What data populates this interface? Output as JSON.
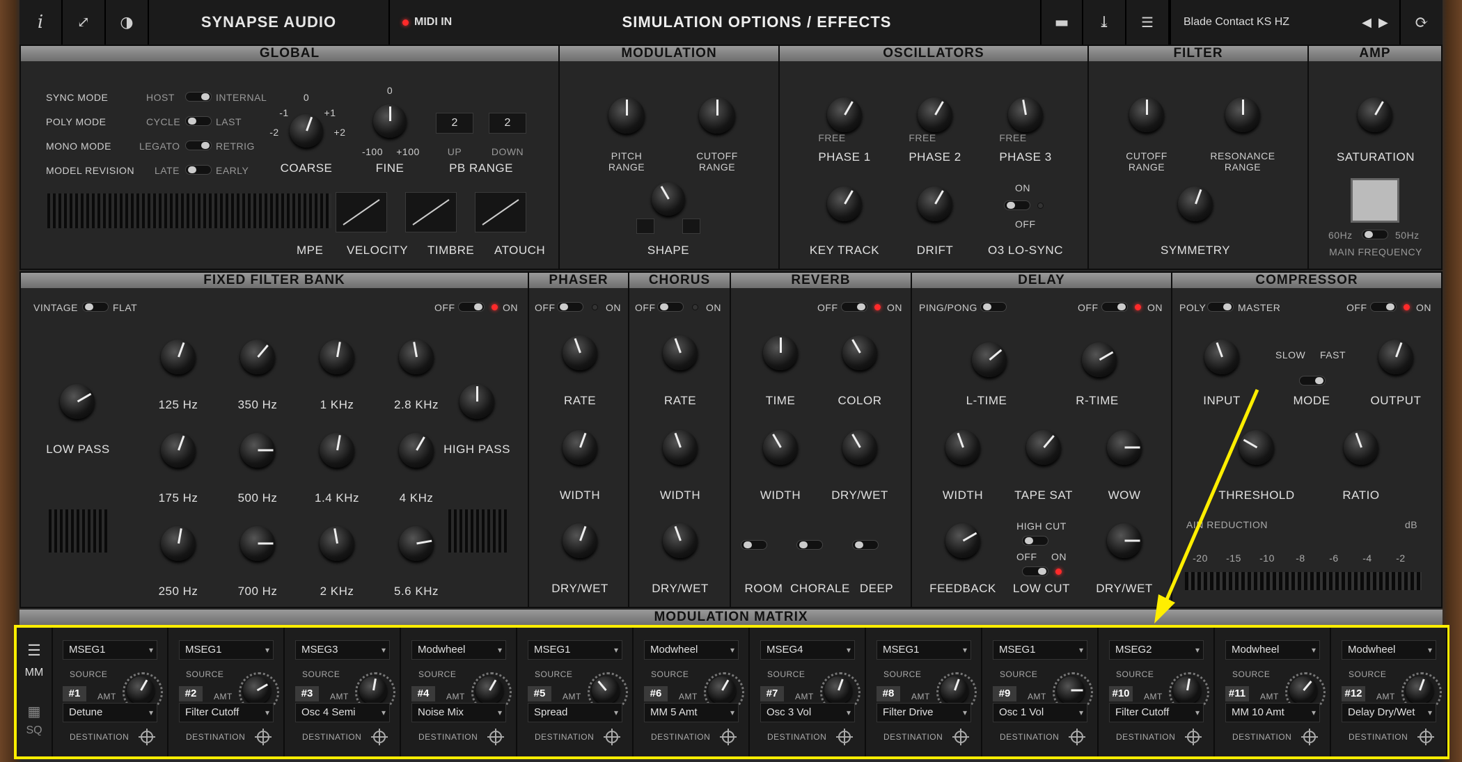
{
  "topbar": {
    "brand": "SYNAPSE AUDIO",
    "midi": "MIDI IN",
    "title": "SIMULATION OPTIONS / EFFECTS",
    "preset": "Blade Contact KS HZ",
    "info_icon": "i",
    "expand_icon": "expand-icon",
    "theme_icon": "contrast-icon"
  },
  "global": {
    "title": "GLOBAL",
    "sync_mode": "SYNC MODE",
    "host": "HOST",
    "internal": "INTERNAL",
    "poly_mode": "POLY MODE",
    "cycle": "CYCLE",
    "last": "LAST",
    "mono_mode": "MONO MODE",
    "legato": "LEGATO",
    "retrig": "RETRIG",
    "model_revision": "MODEL REVISION",
    "late": "LATE",
    "early": "EARLY",
    "coarse": "COARSE",
    "fine": "FINE",
    "pb_range": "PB RANGE",
    "up": "UP",
    "down": "DOWN",
    "pb_up": "2",
    "pb_down": "2",
    "coarse_0": "0",
    "coarse_m1": "-1",
    "coarse_p1": "+1",
    "coarse_m2": "-2",
    "coarse_p2": "+2",
    "fine_0": "0",
    "fine_m": "-100",
    "fine_p": "+100",
    "mpe": "MPE",
    "velocity": "VELOCITY",
    "timbre": "TIMBRE",
    "atouch": "ATOUCH"
  },
  "modulation": {
    "title": "MODULATION",
    "pitch_range": "PITCH\nRANGE",
    "cutoff_range": "CUTOFF\nRANGE",
    "shape": "SHAPE"
  },
  "oscillators": {
    "title": "OSCILLATORS",
    "phase1": "PHASE 1",
    "phase2": "PHASE 2",
    "phase3": "PHASE 3",
    "free": "FREE",
    "key_track": "KEY TRACK",
    "drift": "DRIFT",
    "lo_sync": "O3 LO-SYNC",
    "on": "ON",
    "off": "OFF"
  },
  "filter": {
    "title": "FILTER",
    "cutoff_range": "CUTOFF\nRANGE",
    "resonance_range": "RESONANCE\nRANGE",
    "symmetry": "SYMMETRY"
  },
  "amp": {
    "title": "AMP",
    "saturation": "SATURATION",
    "hz60": "60Hz",
    "hz50": "50Hz",
    "main_frequency": "MAIN FREQUENCY"
  },
  "ffb": {
    "title": "FIXED FILTER BANK",
    "vintage": "VINTAGE",
    "flat": "FLAT",
    "off": "OFF",
    "on": "ON",
    "low_pass": "LOW PASS",
    "high_pass": "HIGH PASS",
    "bands": [
      "125 Hz",
      "350 Hz",
      "1 KHz",
      "2.8 KHz",
      "175 Hz",
      "500 Hz",
      "1.4 KHz",
      "4 KHz",
      "250 Hz",
      "700 Hz",
      "2 KHz",
      "5.6 KHz"
    ]
  },
  "phaser": {
    "title": "PHASER",
    "off": "OFF",
    "on": "ON",
    "rate": "RATE",
    "width": "WIDTH",
    "drywet": "DRY/WET"
  },
  "chorus": {
    "title": "CHORUS",
    "off": "OFF",
    "on": "ON",
    "rate": "RATE",
    "width": "WIDTH",
    "drywet": "DRY/WET"
  },
  "reverb": {
    "title": "REVERB",
    "off": "OFF",
    "on": "ON",
    "time": "TIME",
    "color": "COLOR",
    "width": "WIDTH",
    "drywet": "DRY/WET",
    "room": "ROOM",
    "chorale": "CHORALE",
    "deep": "DEEP"
  },
  "delay": {
    "title": "DELAY",
    "pingpong": "PING/PONG",
    "off": "OFF",
    "on": "ON",
    "ltime": "L-TIME",
    "rtime": "R-TIME",
    "width": "WIDTH",
    "tape_sat": "TAPE SAT",
    "wow": "WOW",
    "feedback": "FEEDBACK",
    "high_cut": "HIGH CUT",
    "low_cut": "LOW CUT",
    "drywet": "DRY/WET"
  },
  "compressor": {
    "title": "COMPRESSOR",
    "poly": "POLY",
    "master": "MASTER",
    "off": "OFF",
    "on": "ON",
    "input": "INPUT",
    "mode": "MODE",
    "slow": "SLOW",
    "fast": "FAST",
    "output": "OUTPUT",
    "threshold": "THRESHOLD",
    "ratio": "RATIO",
    "gain_reduction": "AIN REDUCTION",
    "db": "dB",
    "scale": [
      "-20",
      "-15",
      "-10",
      "-8",
      "-6",
      "-4",
      "-2"
    ]
  },
  "matrix": {
    "title": "MODULATION MATRIX",
    "mm": "MM",
    "sq": "SQ",
    "source_label": "SOURCE",
    "amt_label": "AMT",
    "dest_label": "DESTINATION",
    "slots": [
      {
        "source": "MSEG1",
        "num": "#1",
        "dest": "Detune"
      },
      {
        "source": "MSEG1",
        "num": "#2",
        "dest": "Filter Cutoff"
      },
      {
        "source": "MSEG3",
        "num": "#3",
        "dest": "Osc 4 Semi"
      },
      {
        "source": "Modwheel",
        "num": "#4",
        "dest": "Noise Mix"
      },
      {
        "source": "MSEG1",
        "num": "#5",
        "dest": "Spread"
      },
      {
        "source": "Modwheel",
        "num": "#6",
        "dest": "MM 5 Amt"
      },
      {
        "source": "MSEG4",
        "num": "#7",
        "dest": "Osc 3 Vol"
      },
      {
        "source": "MSEG1",
        "num": "#8",
        "dest": "Filter Drive"
      },
      {
        "source": "MSEG1",
        "num": "#9",
        "dest": "Osc 1 Vol"
      },
      {
        "source": "MSEG2",
        "num": "#10",
        "dest": "Filter Cutoff"
      },
      {
        "source": "Modwheel",
        "num": "#11",
        "dest": "MM 10 Amt"
      },
      {
        "source": "Modwheel",
        "num": "#12",
        "dest": "Delay Dry/Wet"
      }
    ]
  },
  "colors": {
    "highlight": "#ffee00",
    "led": "#ff2a2a"
  }
}
